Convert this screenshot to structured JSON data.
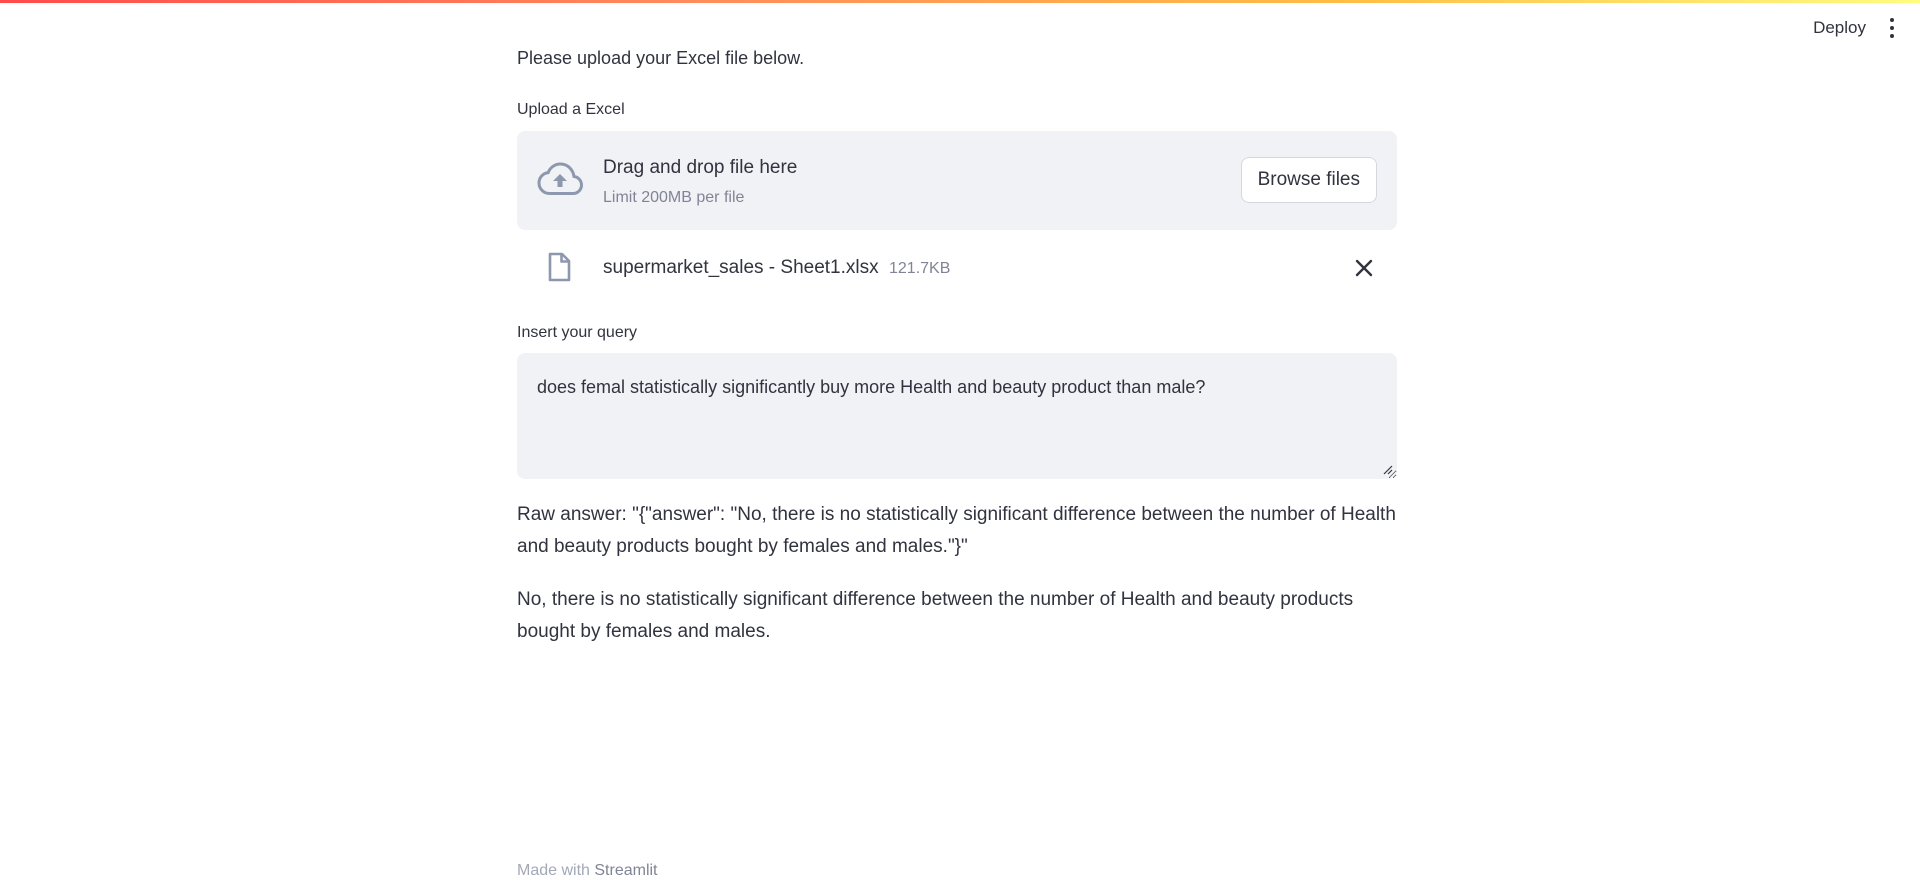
{
  "header": {
    "deploy_label": "Deploy",
    "menu_icon": "kebab-menu-icon"
  },
  "intro_text": "Please upload your Excel file below.",
  "uploader": {
    "label": "Upload a Excel",
    "dropzone_title": "Drag and drop file here",
    "dropzone_limit": "Limit 200MB per file",
    "browse_label": "Browse files",
    "icon": "cloud-upload-icon"
  },
  "uploaded_file": {
    "name": "supermarket_sales - Sheet1.xlsx",
    "size": "121.7KB",
    "icon": "file-icon",
    "remove_icon": "close-icon"
  },
  "query": {
    "label": "Insert your query",
    "value": "does femal statistically significantly buy more Health and beauty product than male?"
  },
  "raw_answer": "Raw answer: \"{\"answer\": \"No, there is no statistically significant difference between the number of Health and beauty products bought by females and males.\"}\"",
  "answer": "No, there is no statistically significant difference between the number of Health and beauty products bought by females and males.",
  "footer": {
    "prefix": "Made with",
    "brand": "Streamlit"
  },
  "colors": {
    "accent_gradient_start": "#ff4b4b",
    "accent_gradient_end": "#fffd80",
    "text": "#31333f",
    "muted": "#808495",
    "panel": "#f0f2f6"
  }
}
